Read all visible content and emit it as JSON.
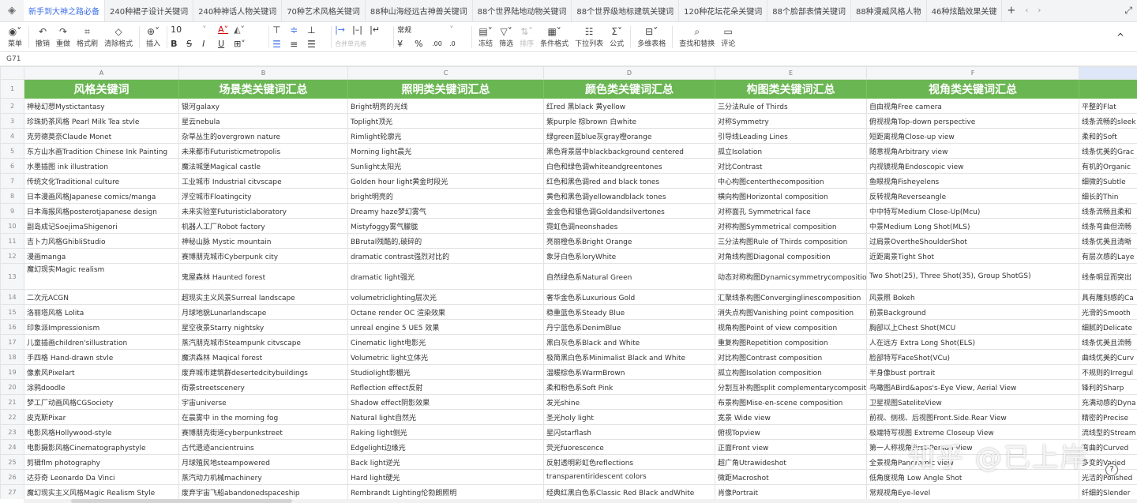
{
  "tabs": {
    "items": [
      "新手到大神之路必备",
      "240种裙子设计关键词",
      "240种神话人物关键词",
      "70种艺术风格关键词",
      "88种山海经远古神兽关键词",
      "88个世界陆地动物关键词",
      "88个世界级地标建筑关键词",
      "120种花坛花朵关键词",
      "88个脸部表情关键词",
      "88种漫威风格人物",
      "46种炫酷效果关键"
    ],
    "add": "+",
    "prev": "‹",
    "next": "›",
    "expand": "⤢"
  },
  "toolbar": {
    "menu": "菜单",
    "undo": "撤销",
    "redo": "重做",
    "painter": "格式刷",
    "clear": "清除格式",
    "insert": "插入",
    "font_size": "10",
    "bold": "B",
    "strike": "S",
    "italic": "I",
    "underline": "U",
    "merge": "合并单元格",
    "number_format": "常规",
    "currency": "¥",
    "percent": "%",
    "dec_add": ".00",
    "dec_sub": ".0",
    "freeze": "冻结",
    "filter": "筛选",
    "sort": "排序",
    "cond_format": "条件格式",
    "dropdown": "下拉列表",
    "formula": "公式",
    "multi_table": "多维表格",
    "find_replace": "查找和替换",
    "comment": "评论",
    "collapse": "^"
  },
  "formula_bar": {
    "cell_ref": "G71"
  },
  "sheet": {
    "columns": [
      "A",
      "B",
      "C",
      "D",
      "E",
      "F",
      ""
    ],
    "headers": [
      "风格关键词",
      "场景类关键词汇总",
      "照明类关键词汇总",
      "颜色类关键词汇总",
      "构图类关键词汇总",
      "视角类关键词汇总",
      ""
    ],
    "rows": [
      {
        "n": "2",
        "c": [
          "神秘幻想Mystictantasy",
          "银河galaxy",
          "Bright明亮的光线",
          "红red 黑black 黄yellow",
          "三分法Rule of Thirds",
          "自由视角Free camera",
          "平整的Flat"
        ]
      },
      {
        "n": "3",
        "c": [
          "珍珠奶茶风格 Pearl Milk Tea stvle",
          "星云nebula",
          "Toplight顶光",
          "紫purple 棕brown 白white",
          "对称Symmetry",
          "俯视视角Top-down perspective",
          "线条流畅的sleek"
        ]
      },
      {
        "n": "4",
        "c": [
          "克劳德莫奈Claude Monet",
          "杂草丛生的overgrown nature",
          "Rimlight轮廓光",
          "绿green蓝blue灰gray橙orange",
          "引导线Leading Lines",
          "短距离视角Close-up view",
          "柔和的Soft"
        ]
      },
      {
        "n": "5",
        "c": [
          "东方山水画Tradition Chinese Ink Painting",
          "未来都市Futuristicmetropolis",
          "Morning light晨光",
          "黑色背景居中blackbackground centered",
          "孤立Isolation",
          "随意视角Arbitrary view",
          "线条优美的Grac"
        ]
      },
      {
        "n": "6",
        "c": [
          "水墨插图 ink illustration",
          "魔法城堡Magical castle",
          "Sunlight太阳光",
          "白色和绿色调whiteandgreentones",
          "对比Contrast",
          "内视镜视角Endoscopic view",
          "有机的Organic"
        ]
      },
      {
        "n": "7",
        "c": [
          "传统文化Traditional culture",
          "工业城市 Industrial citvscape",
          "Golden hour light黄金时段光",
          "红色和黑色调red and black tones",
          "中心构图centerthecomposition",
          "鱼眼视角Fisheyelens",
          "细微的Subtle"
        ]
      },
      {
        "n": "8",
        "c": [
          "日本漫画风格Japanese comics/manga",
          "浮空城市Floatingcity",
          "bright明亮的",
          "黄色和黑色调yellowandblack tones",
          "横向构图Horizontal composition",
          "反转视角Reverseangle",
          "细长的Thin"
        ]
      },
      {
        "n": "9",
        "c": [
          "日本海报风格posterotjapanese design",
          "未来实验室Futuristiclaboratory",
          "Dreamy haze梦幻雾气",
          "金金色和银色调Goldandsilvertones",
          "对称面孔 Symmetrical face",
          "中中特写Medium Close-Up(Mcu)",
          "线条流畅且柔和"
        ]
      },
      {
        "n": "10",
        "c": [
          "副岛成记SoejimaShigenori",
          "机器人工厂Robot factory",
          "Mistyfoggy雾气朦胧",
          "霓虹色调neonshades",
          "对称构图Symmetrical composition",
          "中景Medium Long Shot(MLS)",
          "线条弯曲但流畅"
        ]
      },
      {
        "n": "11",
        "c": [
          "吉卜力风格GhibliStudio",
          "神秘山脉 Mystic mountain",
          "BBrutal残酷的,破碎的",
          "亮丽橙色系Bright Orange",
          "三分法构图Rule of Thirds composition",
          "过肩景OvertheShoulderShot",
          "线条优美且清晰"
        ]
      },
      {
        "n": "12",
        "c": [
          "漫画manga",
          "赛博朋克城市Cyberpunk city",
          "dramatic contrast强烈对比的",
          "象牙白色系loryWhite",
          "对角线构图Diagonal composition",
          "近距离景Tight Shot",
          "有层次感的Laye"
        ]
      },
      {
        "n": "13",
        "c": [
          "魔幻现实Magic realism",
          "鬼屋森林 Haunted forest",
          "dramatic light强光",
          "自然绿色系Natural Green",
          "动态对称构图Dynamicsymmetrycomposition",
          "Two Shot(25), Three Shot(35), Group ShotGS)",
          "线条明显而突出"
        ]
      },
      {
        "n": "14",
        "c": [
          "二次元ACGN",
          "超现实主义风景Surreal landscape",
          "volumetriclighting层次光",
          "奢华金色系Luxurious Gold",
          "汇聚线条构图Converginglinescomposition",
          "风景照 Bokeh",
          "具有雕刻感的Ca"
        ]
      },
      {
        "n": "15",
        "c": [
          "洛丽塔风格 Lolita",
          "月球地貌Lunarlandscape",
          "Octane render OC 渲染效果",
          "稳重蓝色系Steady Blue",
          "消失点构图Vanishing point composition",
          "前景Background",
          "光滑的Smooth"
        ]
      },
      {
        "n": "16",
        "c": [
          "印象派Impressionism",
          "星空夜景Starry nightsky",
          "unreal engine 5 UE5 效果",
          "丹宁蓝色系DenimBlue",
          "视角构图Point of view composition",
          "胸部以上Chest Shot(MCU",
          "细腻的Delicate"
        ]
      },
      {
        "n": "17",
        "c": [
          "儿童插画children'sillustration",
          "蒸汽朋克城市Steampunk citvscape",
          "Cinematic light电影光",
          "黑白灰色系Black and White",
          "重复构图Repetition composition",
          "人在远方 Extra Long Shot(ELS)",
          "线条优美且流畅"
        ]
      },
      {
        "n": "18",
        "c": [
          "手四格 Hand-drawn stvle",
          "魔洪森林 Maqical forest",
          "Volumetric light立体光",
          "极简黑白色系Minimalist Black and White",
          "对比构图Contrast composition",
          "脸部特写FaceShot(VCu)",
          "曲线优美的Curv"
        ]
      },
      {
        "n": "19",
        "c": [
          "像素风Pixelart",
          "废弃城市建筑群desertedcitybuildings",
          "Studiolight影棚光",
          "温暖棕色系WarmBrown",
          "孤立构图Isolation composition",
          "半身像bust portrait",
          "不规则的Irregul"
        ]
      },
      {
        "n": "20",
        "c": [
          "涂鸦doodle",
          "街景streetscenery",
          "Reflection effect反射",
          "柔和粉色系Soft Pink",
          "分割互补构图split complementarycomposition",
          "鸟瞰图ABird&apos's-Eye View, Aerial View",
          "锋利的Sharp"
        ]
      },
      {
        "n": "21",
        "c": [
          "梦工厂动画风格CGSociety",
          "宇宙universe",
          "Shadow effect阴影效果",
          "发光shine",
          "布景构图Mise-en-scene composition",
          "卫星视图SateliteView",
          "充满动感的Dyna"
        ]
      },
      {
        "n": "22",
        "c": [
          "皮克斯Pixar",
          "在晨雾中 in the morning fog",
          "Natural light自然光",
          "圣光holy light",
          "宽景 Wide view",
          "前视、侧视、后视图Front.Side.Rear View",
          "精密的Precise"
        ]
      },
      {
        "n": "23",
        "c": [
          "电影风格Hollywood-style",
          "赛博朋克街道cyberpunkstreet",
          "Raking light侧光",
          "星闪starflash",
          "俯视Topview",
          "极端特写视图 Extreme Closeup View",
          "流线型的Stream"
        ]
      },
      {
        "n": "24",
        "c": [
          "电影摄影风格Cinematographystyle",
          "古代遗迹ancientruins",
          "Edgelight边缘光",
          "荧光fuorescence",
          "正面Front view",
          "第一人称视角First-Person View",
          "弯曲的Curved"
        ]
      },
      {
        "n": "25",
        "c": [
          "剪辑flm photography",
          "月球殖民地steampowered",
          "Back light逆光",
          "反射透明彩虹色reflections",
          "超广角Utrawideshot",
          "全景视角Panoramic view",
          "多变的Varied"
        ]
      },
      {
        "n": "26",
        "c": [
          "达芬奇 Leonardo Da Vinci",
          "蒸汽动力机械machinery",
          "Hard light硬光",
          "transparentiridescent colors",
          "微距Macroshot",
          "低角度视角 Low Angle Shot",
          "光洁的Polished"
        ]
      },
      {
        "n": "27",
        "c": [
          "魔幻现实主义风格Magic Realism Style",
          "废弃宇宙飞船abandonedspaceship",
          "Rembrandt Lighting伦勃朗照明",
          "经典红黑白色系Classic Red Black andWhite",
          "肖像Portrait",
          "常规视角Eye-level",
          "纤细的Slender"
        ]
      }
    ]
  },
  "watermark": "知乎 @已上岸",
  "colors": {
    "header_green": "#6ab653",
    "accent": "#3d6fe8"
  }
}
